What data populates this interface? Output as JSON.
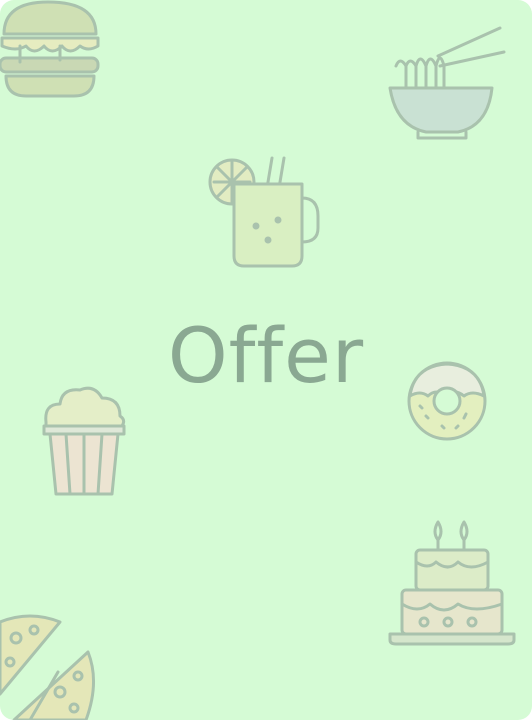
{
  "offer_card": {
    "title": "Offer",
    "background_color": "#d5fbd5",
    "icon_outline_color": "#a9c2ad",
    "icons": [
      "burger-icon",
      "noodle-bowl-icon",
      "lemonade-mug-icon",
      "donut-icon",
      "popcorn-icon",
      "birthday-cake-icon",
      "pizza-icon"
    ]
  }
}
